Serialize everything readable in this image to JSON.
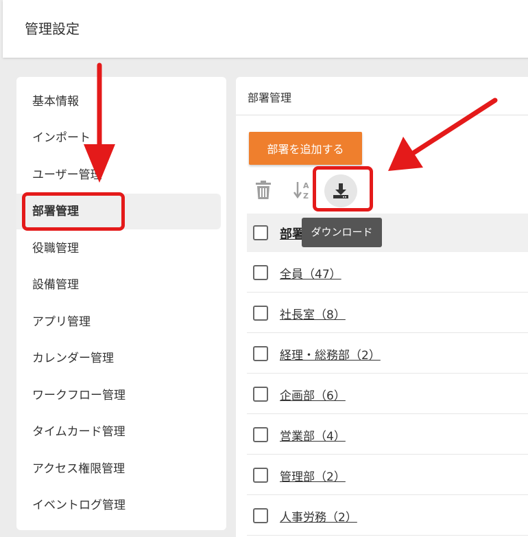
{
  "header": {
    "title": "管理設定"
  },
  "sidebar": {
    "items": [
      {
        "label": "基本情報"
      },
      {
        "label": "インポート"
      },
      {
        "label": "ユーザー管理"
      },
      {
        "label": "部署管理",
        "active": true
      },
      {
        "label": "役職管理"
      },
      {
        "label": "設備管理"
      },
      {
        "label": "アプリ管理"
      },
      {
        "label": "カレンダー管理"
      },
      {
        "label": "ワークフロー管理"
      },
      {
        "label": "タイムカード管理"
      },
      {
        "label": "アクセス権限管理"
      },
      {
        "label": "イベントログ管理"
      }
    ]
  },
  "main": {
    "title": "部署管理",
    "add_button": "部署を追加する",
    "toolbar": {
      "delete_icon": "trash-icon",
      "sort_icon": "sort-az-icon",
      "download_icon": "download-icon"
    },
    "tooltip": "ダウンロード",
    "list_header": "部署",
    "rows": [
      {
        "label": "全員（47）"
      },
      {
        "label": "社長室（8）"
      },
      {
        "label": "経理・総務部（2）"
      },
      {
        "label": "企画部（6）"
      },
      {
        "label": "営業部（4）"
      },
      {
        "label": "管理部（2）"
      },
      {
        "label": "人事労務（2）"
      }
    ]
  },
  "colors": {
    "accent": "#ef7f2d",
    "annotation": "#e41a1a",
    "tooltip_bg": "#555555"
  }
}
